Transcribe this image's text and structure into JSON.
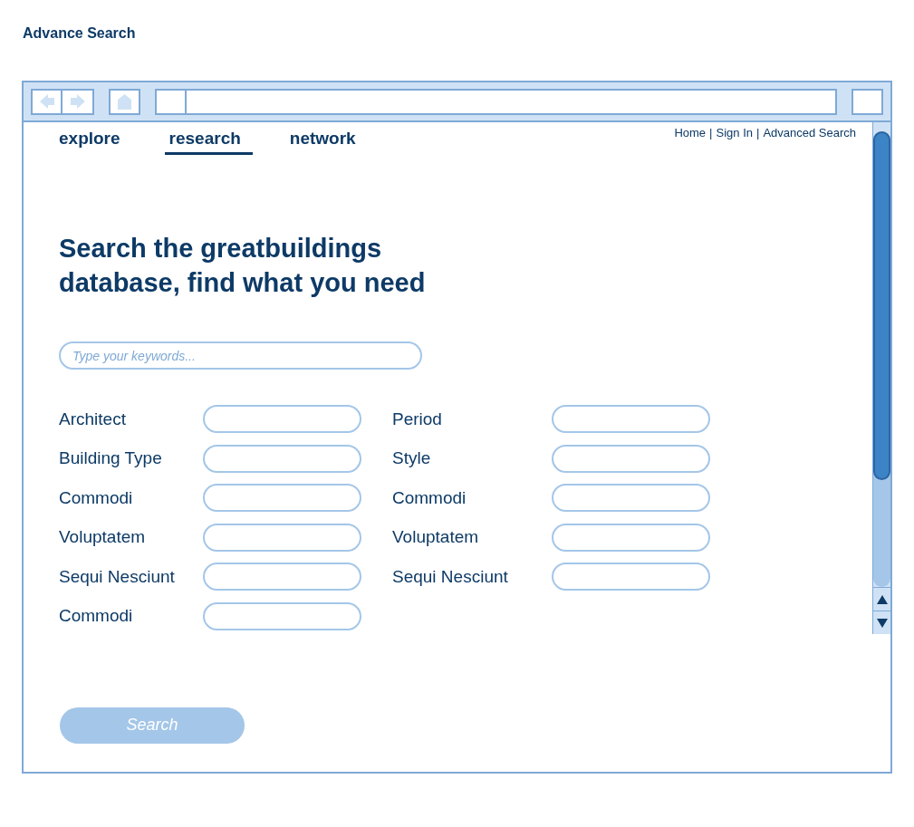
{
  "page_title": "Advance Search",
  "nav_tabs": [
    {
      "label": "explore",
      "selected": false
    },
    {
      "label": "research",
      "selected": true
    },
    {
      "label": "network",
      "selected": false
    }
  ],
  "top_links": [
    "Home",
    "Sign In",
    "Advanced Search"
  ],
  "link_separator": "|",
  "heading": "Search the greatbuildings database, find what you need",
  "keyword_field": {
    "placeholder": "Type your keywords..."
  },
  "left_fields": [
    {
      "label": "Architect"
    },
    {
      "label": "Building Type"
    },
    {
      "label": "Commodi"
    },
    {
      "label": "Voluptatem"
    },
    {
      "label": "Sequi Nesciunt"
    },
    {
      "label": "Commodi"
    }
  ],
  "right_fields": [
    {
      "label": "Period"
    },
    {
      "label": "Style"
    },
    {
      "label": "Commodi"
    },
    {
      "label": "Voluptatem"
    },
    {
      "label": "Sequi Nesciunt"
    }
  ],
  "search_button": {
    "label": "Search",
    "disabled": true
  }
}
